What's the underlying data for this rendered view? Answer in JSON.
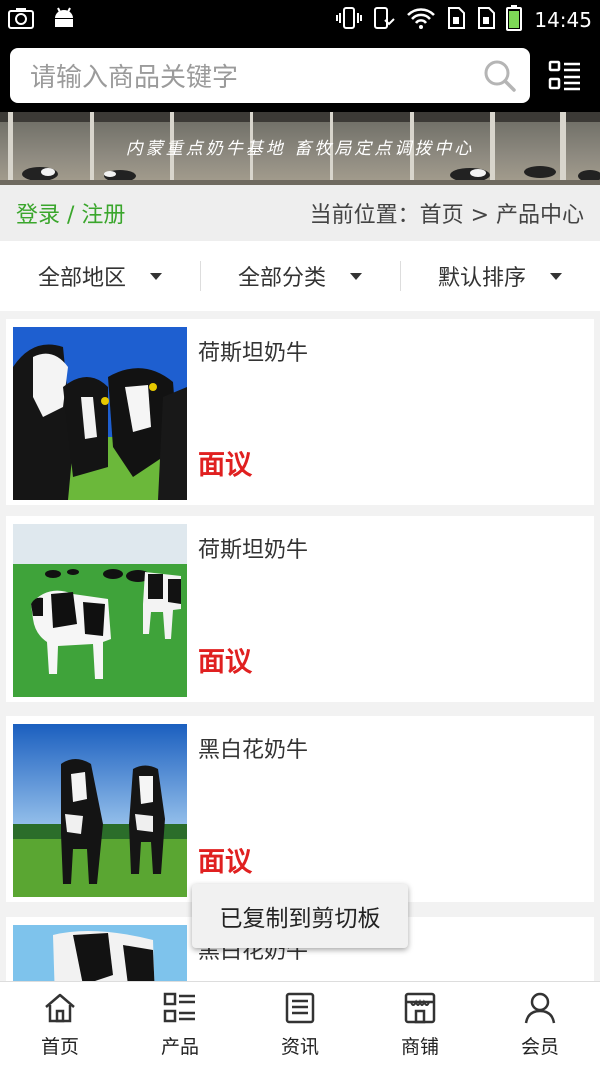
{
  "status_bar": {
    "time": "14:45",
    "icons": [
      "camera-icon",
      "android-icon",
      "vibrate-icon",
      "mute-icon",
      "wifi-icon",
      "sim1-icon",
      "sim2-icon",
      "battery-icon"
    ]
  },
  "header": {
    "search_placeholder": "请输入商品关键字",
    "menu_icon": "list-menu-icon"
  },
  "banner": {
    "text": "内蒙重点奶牛基地 畜牧局定点调拨中心"
  },
  "crumb_bar": {
    "login_link": "登录 / 注册",
    "breadcrumb": "当前位置：首页 > 产品中心"
  },
  "filters": [
    {
      "label": "全部地区"
    },
    {
      "label": "全部分类"
    },
    {
      "label": "默认排序"
    }
  ],
  "products": [
    {
      "name": "荷斯坦奶牛",
      "price": "面议"
    },
    {
      "name": "荷斯坦奶牛",
      "price": "面议"
    },
    {
      "name": "黑白花奶牛",
      "price": "面议"
    },
    {
      "name": "黑白花奶牛",
      "price": ""
    }
  ],
  "toast": {
    "text": "已复制到剪切板"
  },
  "bottom_nav": [
    {
      "label": "首页",
      "icon": "home-icon"
    },
    {
      "label": "产品",
      "icon": "product-grid-icon"
    },
    {
      "label": "资讯",
      "icon": "news-icon"
    },
    {
      "label": "商铺",
      "icon": "shop-icon"
    },
    {
      "label": "会员",
      "icon": "user-icon"
    }
  ],
  "colors": {
    "accent_green": "#3aa62c",
    "price_red": "#e02020"
  }
}
